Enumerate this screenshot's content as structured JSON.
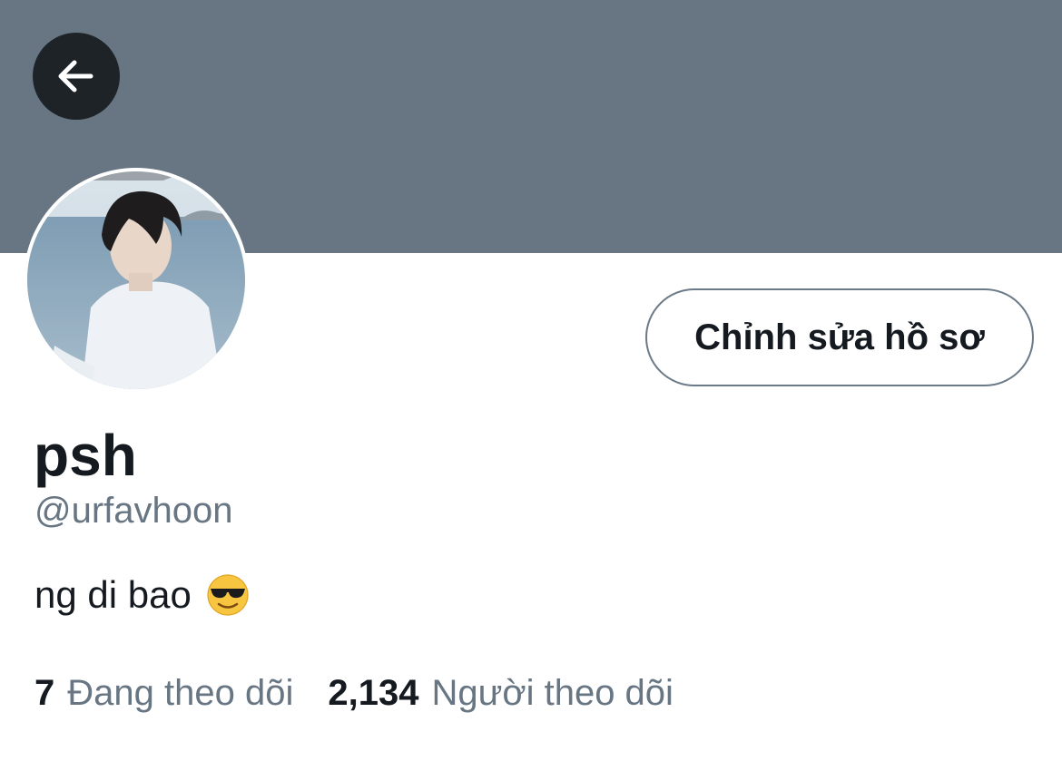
{
  "header": {
    "banner_color": "#687684",
    "back_icon": "arrow-left-icon"
  },
  "profile": {
    "display_name": "psh",
    "handle": "@urfavhoon",
    "bio": "ng di bao",
    "bio_emoji": "smiling-face-with-sunglasses-icon",
    "edit_button_label": "Chỉnh sửa hồ sơ"
  },
  "stats": {
    "following_count": "7",
    "following_label": "Đang theo dõi",
    "followers_count": "2,134",
    "followers_label": "Người theo dõi"
  }
}
